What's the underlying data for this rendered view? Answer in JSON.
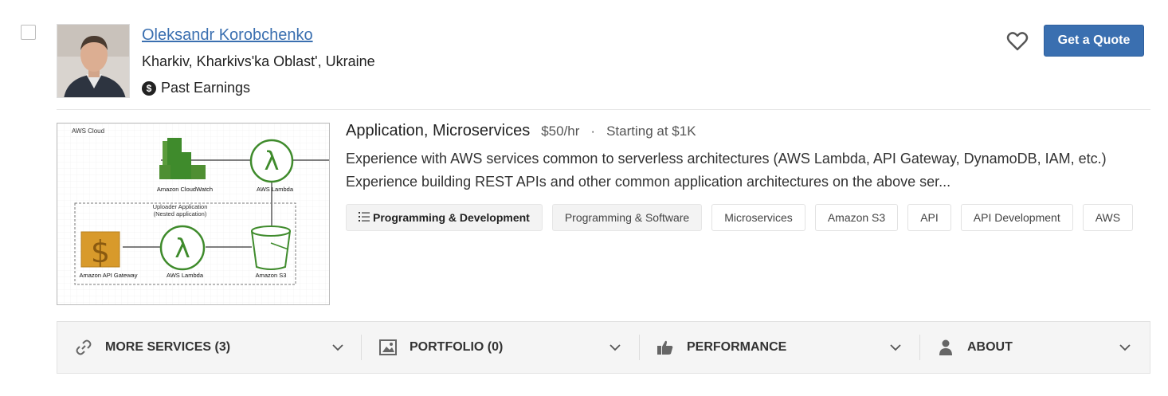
{
  "profile": {
    "name": "Oleksandr Korobchenko",
    "location": "Kharkiv, Kharkivs'ka Oblast', Ukraine",
    "earnings_label": "Past Earnings",
    "quote_button": "Get a Quote"
  },
  "service": {
    "title": "Application, Microservices",
    "rate": "$50/hr",
    "separator": "·",
    "starting": "Starting at $1K",
    "description_line1": "Experience with AWS services common to serverless architectures (AWS Lambda, API Gateway, DynamoDB, IAM, etc.)",
    "description_line2": "Experience building REST APIs and other common application architectures on the above ser...",
    "tags": [
      "Programming & Development",
      "Programming & Software",
      "Microservices",
      "Amazon S3",
      "API",
      "API Development",
      "AWS"
    ],
    "diagram": {
      "cloud_label": "AWS Cloud",
      "cloudwatch": "Amazon CloudWatch",
      "lambda_top": "AWS Lambda",
      "nested_line1": "Uploader Application",
      "nested_line2": "(Nested application)",
      "gateway": "Amazon API Gateway",
      "lambda_bottom": "AWS Lambda",
      "s3": "Amazon S3"
    }
  },
  "footer": {
    "more_services": "MORE SERVICES (3)",
    "portfolio": "PORTFOLIO (0)",
    "performance": "PERFORMANCE",
    "about": "ABOUT"
  },
  "colors": {
    "accent": "#3a6fb0",
    "aws_green": "#3f8b2c",
    "aws_orange": "#d89a2b"
  },
  "icons": [
    "heart-icon",
    "dollar-icon",
    "list-icon",
    "link-icon",
    "image-icon",
    "thumbs-up-icon",
    "user-icon",
    "chevron-down-icon"
  ]
}
